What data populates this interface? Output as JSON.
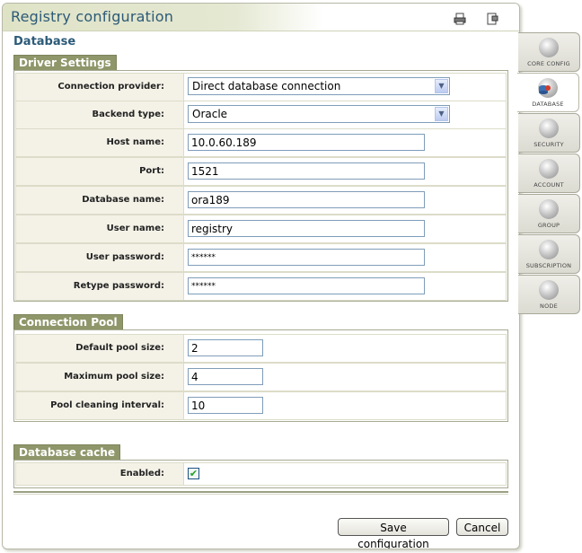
{
  "window": {
    "title": "Registry configuration"
  },
  "toolbar": {
    "print_icon": "printer-icon",
    "export_icon": "document-export-icon"
  },
  "section": {
    "title": "Database"
  },
  "driver": {
    "legend": "Driver Settings",
    "connection_provider": {
      "label": "Connection provider:",
      "value": "Direct database connection"
    },
    "backend_type": {
      "label": "Backend type:",
      "value": "Oracle"
    },
    "host_name": {
      "label": "Host name:",
      "value": "10.0.60.189"
    },
    "port": {
      "label": "Port:",
      "value": "1521"
    },
    "database_name": {
      "label": "Database name:",
      "value": "ora189"
    },
    "user_name": {
      "label": "User name:",
      "value": "registry"
    },
    "user_password": {
      "label": "User password:",
      "value": "******"
    },
    "retype_password": {
      "label": "Retype password:",
      "value": "******"
    }
  },
  "pool": {
    "legend": "Connection Pool",
    "default_size": {
      "label": "Default pool size:",
      "value": "2"
    },
    "max_size": {
      "label": "Maximum pool size:",
      "value": "4"
    },
    "cleaning_interval": {
      "label": "Pool cleaning interval:",
      "value": "10"
    }
  },
  "cache": {
    "legend": "Database cache",
    "enabled": {
      "label": "Enabled:",
      "checked": true,
      "mark": "✔"
    }
  },
  "buttons": {
    "save": "Save configuration",
    "cancel": "Cancel"
  },
  "tabs": [
    {
      "label": "CORE CONFIG",
      "icon": "gear-icon",
      "active": false
    },
    {
      "label": "DATABASE",
      "icon": "database-icon",
      "active": true
    },
    {
      "label": "SECURITY",
      "icon": "lock-icon",
      "active": false
    },
    {
      "label": "ACCOUNT",
      "icon": "account-icon",
      "active": false
    },
    {
      "label": "GROUP",
      "icon": "group-icon",
      "active": false
    },
    {
      "label": "SUBSCRIPTION",
      "icon": "subscription-icon",
      "active": false
    },
    {
      "label": "NODE",
      "icon": "node-icon",
      "active": false
    }
  ]
}
